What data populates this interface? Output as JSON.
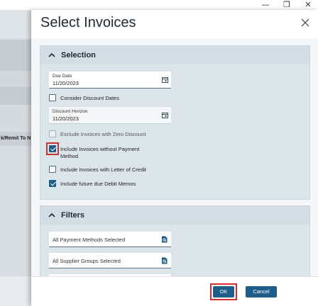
{
  "window_controls": {
    "minimize": "—",
    "restore": "❐",
    "close": "✕"
  },
  "background": {
    "column_header": "k/Remit To N"
  },
  "dialog": {
    "title": "Select Invoices",
    "close_icon": "close-icon"
  },
  "selection": {
    "title": "Selection",
    "due_date": {
      "label": "Due Date",
      "value": "11/20/2023"
    },
    "consider_discount_dates": {
      "label": "Consider Discount Dates",
      "checked": false
    },
    "discount_horizon": {
      "label": "Discount Horizon",
      "value": "11/20/2023"
    },
    "exclude_zero_discount": {
      "label": "Exclude Invoices with Zero Discount",
      "checked": false
    },
    "include_without_payment_method": {
      "label_line1": "Include Invoices without Payment",
      "label_line2": "Method",
      "checked": true
    },
    "include_letter_of_credit": {
      "label": "Include Invoices with Letter of Credit",
      "checked": false
    },
    "include_future_debit_memos": {
      "label": "Include future due Debit Memos",
      "checked": true
    }
  },
  "filters": {
    "title": "Filters",
    "payment_methods": "All Payment Methods Selected",
    "supplier_groups": "All Supplier Groups Selected"
  },
  "footer": {
    "ok_label": "OK",
    "cancel_label": "Cancel"
  },
  "colors": {
    "accent": "#1f5d8a",
    "highlight": "#d32f2f"
  }
}
